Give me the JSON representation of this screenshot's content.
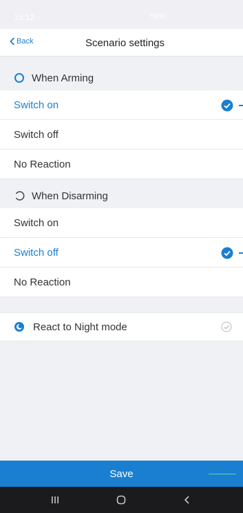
{
  "status_bar": {
    "time": "15:12",
    "system": "59%"
  },
  "navbar": {
    "back_label": "Back",
    "title": "Scenario settings"
  },
  "arming": {
    "title": "When Arming",
    "options": [
      {
        "label": "Switch on",
        "selected": true
      },
      {
        "label": "Switch off",
        "selected": false
      },
      {
        "label": "No Reaction",
        "selected": false
      }
    ]
  },
  "disarming": {
    "title": "When Disarming",
    "options": [
      {
        "label": "Switch on",
        "selected": false
      },
      {
        "label": "Switch off",
        "selected": true
      },
      {
        "label": "No Reaction",
        "selected": false
      }
    ]
  },
  "night_mode": {
    "label": "React to Night mode",
    "enabled": false
  },
  "save": {
    "label": "Save"
  },
  "colors": {
    "accent": "#1a7fd0",
    "background": "#f0f1f5"
  },
  "icons": {
    "back": "chevron-left-icon",
    "arming": "circle-outline-icon",
    "disarming": "open-circle-icon",
    "night": "night-mode-icon",
    "selected": "check-circle-icon",
    "unselected_toggle": "check-outline-icon",
    "nav_recents": "recents-icon",
    "nav_home": "home-icon",
    "nav_back": "back-icon"
  }
}
